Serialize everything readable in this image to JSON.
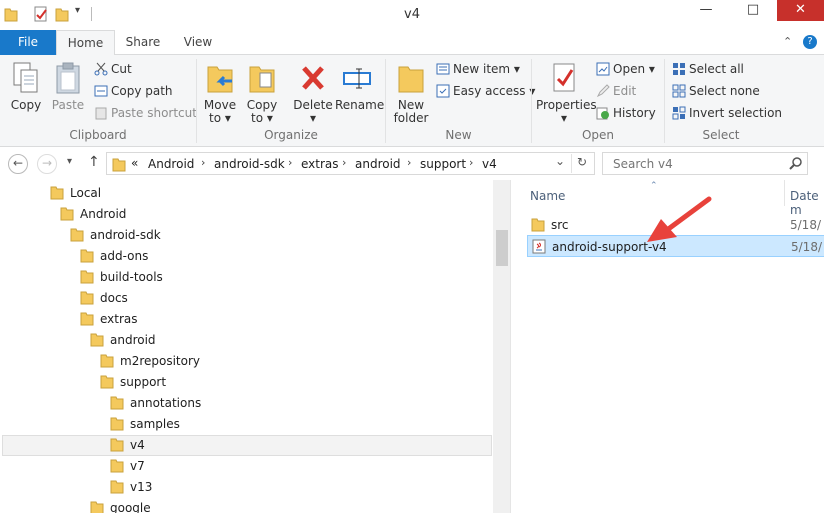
{
  "window": {
    "title": "v4",
    "minimize": "—",
    "maximize": "□",
    "close": "✕"
  },
  "tabs": {
    "file": "File",
    "home": "Home",
    "share": "Share",
    "view": "View"
  },
  "ribbon": {
    "clipboard": {
      "copy": "Copy",
      "paste": "Paste",
      "cut": "Cut",
      "copy_path": "Copy path",
      "paste_shortcut": "Paste shortcut",
      "label": "Clipboard"
    },
    "organize": {
      "move_to": "Move",
      "move_to_2": "to ▾",
      "copy_to": "Copy",
      "copy_to_2": "to ▾",
      "delete": "Delete",
      "delete_2": "▾",
      "rename": "Rename",
      "label": "Organize"
    },
    "new": {
      "new_folder": "New",
      "new_folder_2": "folder",
      "new_item": "New item ▾",
      "easy_access": "Easy access ▾",
      "label": "New"
    },
    "open": {
      "properties": "Properties",
      "properties_2": "▾",
      "open": "Open ▾",
      "edit": "Edit",
      "history": "History",
      "label": "Open"
    },
    "select": {
      "select_all": "Select all",
      "select_none": "Select none",
      "invert": "Invert selection",
      "label": "Select"
    }
  },
  "address": {
    "overflow": "«",
    "crumbs": [
      "Android",
      "android-sdk",
      "extras",
      "android",
      "support",
      "v4"
    ],
    "sep": "›",
    "dropdown": "⌄",
    "refresh": "↻"
  },
  "search": {
    "placeholder": "Search v4"
  },
  "tree": {
    "items": [
      "Local",
      "Android",
      "android-sdk",
      "add-ons",
      "build-tools",
      "docs",
      "extras",
      "android",
      "m2repository",
      "support",
      "annotations",
      "samples",
      "v4",
      "v7",
      "v13",
      "google"
    ]
  },
  "files": {
    "col_name": "Name",
    "col_date": "Date m",
    "rows": [
      {
        "name": "src",
        "date": "5/18/"
      },
      {
        "name": "android-support-v4",
        "date": "5/18/"
      }
    ]
  },
  "colors": {
    "accent": "#1979ca",
    "selection": "#cce8ff",
    "arrow": "#e8423b"
  }
}
